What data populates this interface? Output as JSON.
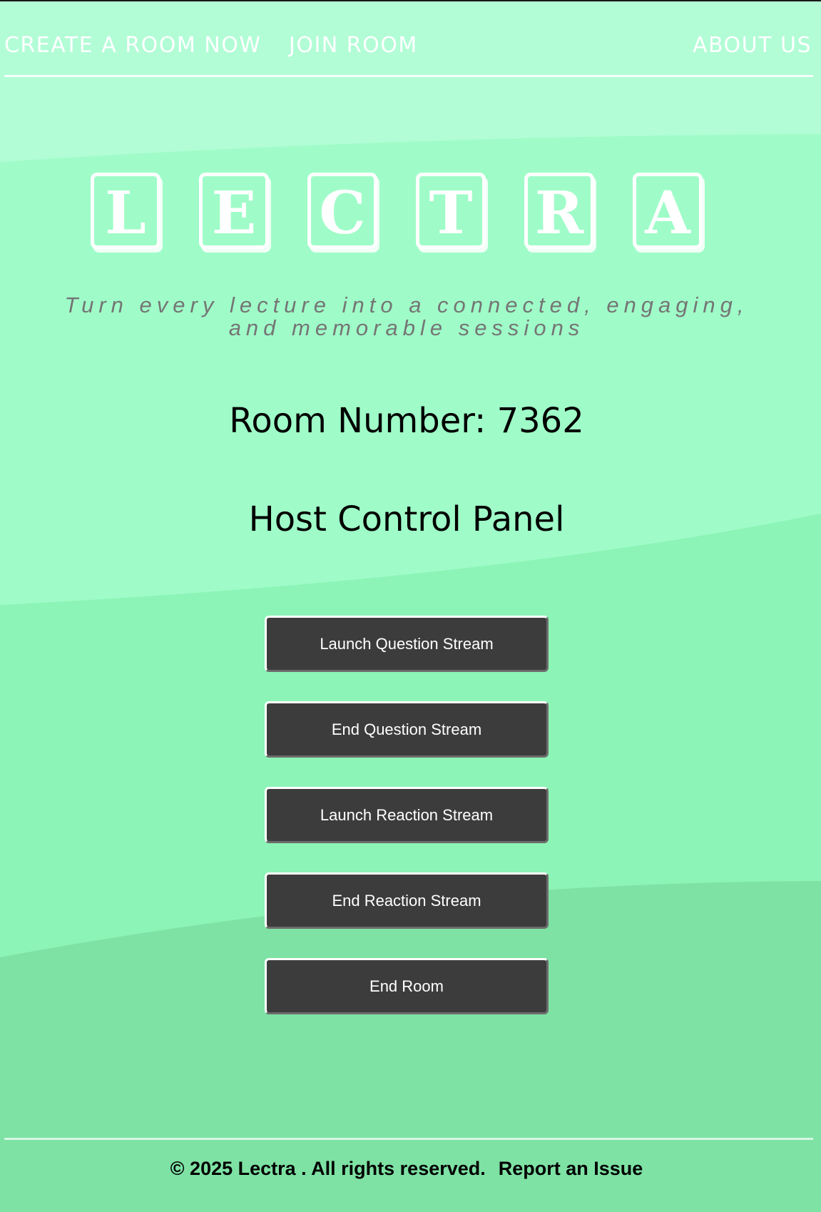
{
  "nav": {
    "create_room": "CREATE A ROOM NOW",
    "join_room": "JOIN ROOM",
    "about_us": "ABOUT US"
  },
  "logo": {
    "letters": [
      "L",
      "E",
      "C",
      "T",
      "R",
      "A"
    ]
  },
  "tagline": "Turn every lecture into a connected, engaging, and memorable sessions",
  "room": {
    "label": "Room Number: 7362"
  },
  "panel": {
    "title": "Host Control Panel",
    "buttons": [
      "Launch Question Stream",
      "End Question Stream",
      "Launch Reaction Stream",
      "End Reaction Stream",
      "End Room"
    ]
  },
  "footer": {
    "copyright": "© 2025 Lectra . All rights reserved.",
    "report_link": "Report an Issue"
  },
  "colors": {
    "bg_top": "#b2fdd6",
    "bg_band_2": "#9ffcc8",
    "bg_band_3": "#8cf4b6",
    "bg_bottom": "#7ee2a4",
    "button_bg": "#3c3c3c",
    "tagline_text": "#757575"
  }
}
